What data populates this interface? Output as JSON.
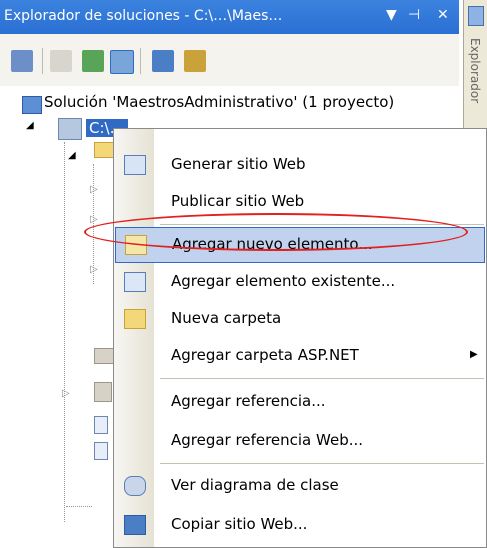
{
  "window": {
    "title": "Explorador de soluciones - C:\\…\\Maes…",
    "side_tab": "Explorador"
  },
  "tree": {
    "solution_label": "Solución 'MaestrosAdministrativo' (1 proyecto)",
    "project_label": "C:\\…"
  },
  "context_menu": {
    "items": [
      {
        "label": "Generar sitio Web",
        "icon": "build-icon"
      },
      {
        "label": "Publicar sitio Web",
        "icon": ""
      },
      {
        "label": "Agregar nuevo elemento...",
        "icon": "add-new-item-icon",
        "highlighted": true
      },
      {
        "label": "Agregar elemento existente...",
        "icon": "add-existing-item-icon"
      },
      {
        "label": "Nueva carpeta",
        "icon": "new-folder-icon"
      },
      {
        "label": "Agregar carpeta ASP.NET",
        "icon": "",
        "submenu": true
      },
      {
        "label": "Agregar referencia...",
        "icon": ""
      },
      {
        "label": "Agregar referencia Web...",
        "icon": ""
      },
      {
        "label": "Ver diagrama de clase",
        "icon": "class-diagram-icon"
      },
      {
        "label": "Copiar sitio Web...",
        "icon": "copy-website-icon"
      }
    ]
  },
  "colors": {
    "titlebar": "#2a6fd3",
    "highlight_bg": "#c1d2ee",
    "highlight_border": "#316ac5",
    "annotation_oval": "#e22020"
  }
}
